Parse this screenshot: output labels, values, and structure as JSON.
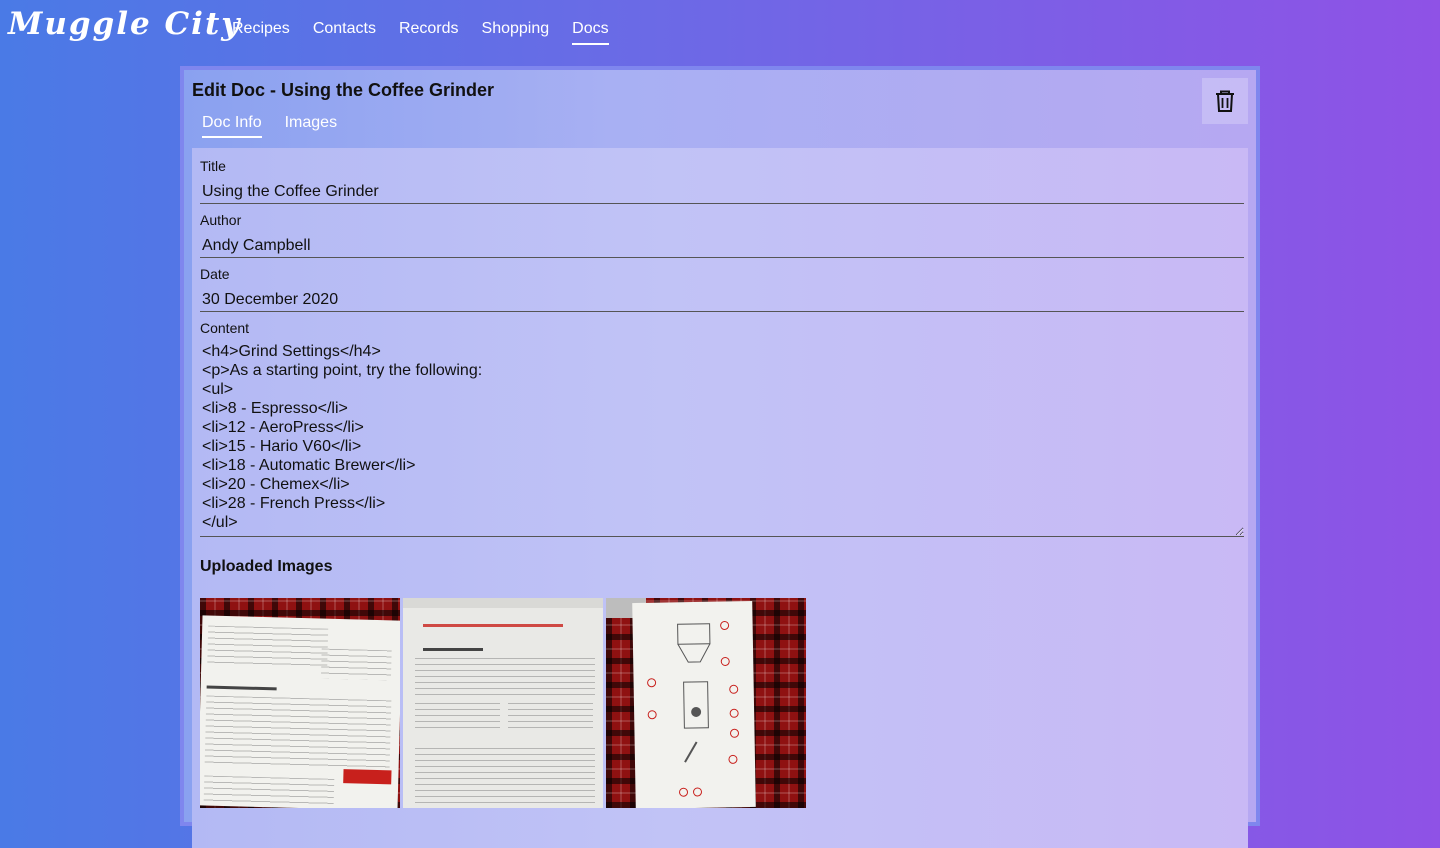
{
  "header": {
    "logo": "Muggle City",
    "nav": [
      {
        "label": "Recipes"
      },
      {
        "label": "Contacts"
      },
      {
        "label": "Records"
      },
      {
        "label": "Shopping"
      },
      {
        "label": "Docs",
        "active": true
      }
    ]
  },
  "editor": {
    "heading": "Edit Doc - Using the Coffee Grinder",
    "tabs": [
      {
        "label": "Doc Info",
        "active": true
      },
      {
        "label": "Images"
      }
    ],
    "delete_icon": "trash-icon"
  },
  "form": {
    "title_label": "Title",
    "title_value": "Using the Coffee Grinder",
    "author_label": "Author",
    "author_value": "Andy Campbell",
    "date_label": "Date",
    "date_value": "30 December 2020",
    "content_label": "Content",
    "content_value": "<h4>Grind Settings</h4>\n<p>As a starting point, try the following:\n<ul>\n<li>8 - Espresso</li>\n<li>12 - AeroPress</li>\n<li>15 - Hario V60</li>\n<li>18 - Automatic Brewer</li>\n<li>20 - Chemex</li>\n<li>28 - French Press</li>\n</ul>"
  },
  "uploads": {
    "heading": "Uploaded Images",
    "images": [
      {
        "name": "quick start guide page"
      },
      {
        "name": "programming instructions page"
      },
      {
        "name": "grinder parts diagram page"
      }
    ]
  },
  "colors": {
    "accent_red": "#c8201c",
    "gradient_left": "#4a7ae6",
    "gradient_right": "#8f52e6"
  }
}
